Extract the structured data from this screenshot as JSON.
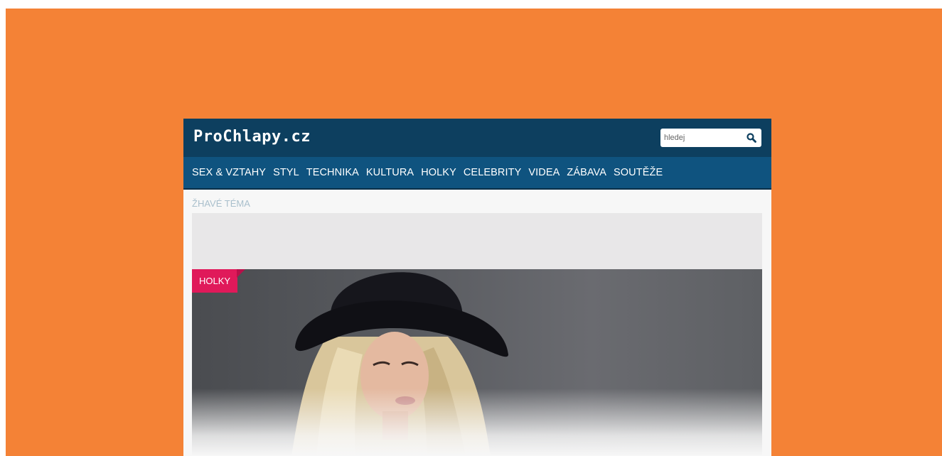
{
  "site": {
    "logo": "ProChlapy.cz"
  },
  "search": {
    "placeholder": "hledej"
  },
  "nav": {
    "items": [
      "SEX & VZTAHY",
      "STYL",
      "TECHNIKA",
      "KULTURA",
      "HOLKY",
      "CELEBRITY",
      "VIDEA",
      "ZÁBAVA",
      "SOUTĚŽE"
    ]
  },
  "hot_topic": {
    "label": "ŽHAVÉ TÉMA"
  },
  "featured": {
    "category": "HOLKY"
  },
  "colors": {
    "backdrop": "#f48236",
    "header": "#0d3f5f",
    "nav": "#0f537f",
    "badge": "#e0195a"
  }
}
